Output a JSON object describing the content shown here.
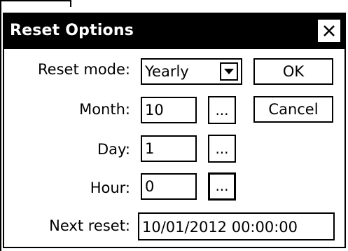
{
  "dialog": {
    "title": "Reset Options",
    "close_icon": "close-x-icon"
  },
  "form": {
    "reset_mode_label": "Reset mode:",
    "reset_mode_value": "Yearly",
    "month_label": "Month:",
    "month_value": "10",
    "day_label": "Day:",
    "day_value": "1",
    "hour_label": "Hour:",
    "hour_value": "0",
    "next_reset_label": "Next reset:",
    "next_reset_value": "10/01/2012 00:00:00",
    "browse_label": "..."
  },
  "buttons": {
    "ok": "OK",
    "cancel": "Cancel"
  }
}
